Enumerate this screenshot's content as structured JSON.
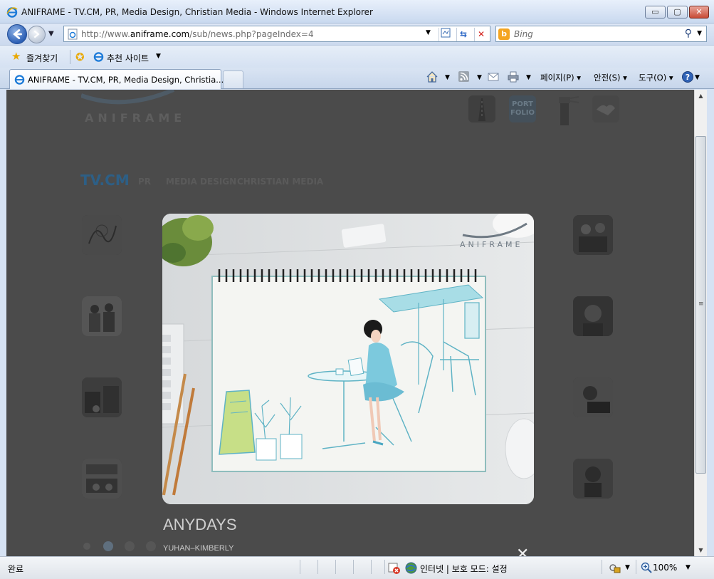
{
  "window": {
    "title": "ANIFRAME - TV.CM, PR, Media Design, Christian Media - Windows Internet Explorer",
    "buttons": {
      "minimize": "▭",
      "maximize": "▢",
      "close": "✕"
    }
  },
  "navigation": {
    "url_prefix": "http://www.",
    "url_domain": "aniframe.com",
    "url_path": "/sub/news.php?pageIndex=4",
    "search_placeholder": "Bing"
  },
  "favorites": {
    "label": "즐겨찾기",
    "suggested_sites": "추천 사이트"
  },
  "tabs": [
    {
      "title": "ANIFRAME - TV.CM, PR, Media Design, Christia..."
    }
  ],
  "command_bar": {
    "page": "페이지(P)",
    "safety": "안전(S)",
    "tools": "도구(O)"
  },
  "site": {
    "logo_text": "ANIFRAME",
    "portfolio_icon": "PORT FOLIO",
    "menu": [
      {
        "label": "TV.CM",
        "active": true
      },
      {
        "label": "PR",
        "active": false
      },
      {
        "label": "MEDIA DESIGN",
        "active": false
      },
      {
        "label": "CHRISTIAN MEDIA",
        "active": false
      }
    ],
    "pager_dots": 4,
    "pager_active": 2
  },
  "lightbox": {
    "title": "ANYDAYS",
    "subtitle": "YUHAN–KIMBERLY",
    "watermark": "ANIFRAME",
    "close_icon": "close-icon"
  },
  "statusbar": {
    "status": "완료",
    "zone": "인터넷 | 보호 모드: 설정",
    "zoom": "100%"
  },
  "colors": {
    "overlay": "#4b4b4b",
    "menu_active": "#2d5f86",
    "ie_blue": "#2c5fb4"
  }
}
